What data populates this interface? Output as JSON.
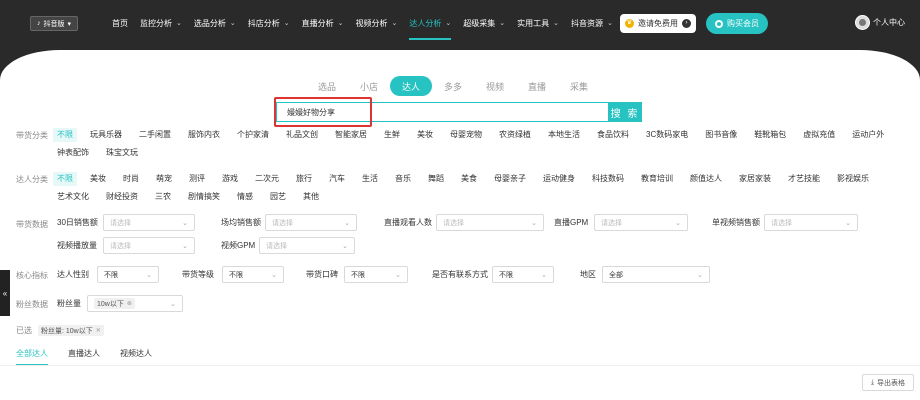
{
  "header": {
    "platform": "抖音版",
    "nav": [
      {
        "label": "首页",
        "chev": false,
        "active": false
      },
      {
        "label": "监控分析",
        "chev": true,
        "active": false
      },
      {
        "label": "选品分析",
        "chev": true,
        "active": false
      },
      {
        "label": "抖店分析",
        "chev": true,
        "active": false
      },
      {
        "label": "直播分析",
        "chev": true,
        "active": false
      },
      {
        "label": "视频分析",
        "chev": true,
        "active": false
      },
      {
        "label": "达人分析",
        "chev": true,
        "active": true
      },
      {
        "label": "超级采集",
        "chev": true,
        "active": false
      },
      {
        "label": "实用工具",
        "chev": true,
        "active": false
      },
      {
        "label": "抖音资源",
        "chev": true,
        "active": false
      }
    ],
    "invite_label": "邀请免费用",
    "buy_label": "购买会员",
    "user_label": "个人中心"
  },
  "tabs": [
    {
      "label": "选品",
      "active": false
    },
    {
      "label": "小店",
      "active": false
    },
    {
      "label": "达人",
      "active": true
    },
    {
      "label": "多多",
      "active": false
    },
    {
      "label": "视频",
      "active": false
    },
    {
      "label": "直播",
      "active": false
    },
    {
      "label": "采集",
      "active": false
    }
  ],
  "search": {
    "value": "嫚嫚好物分享",
    "button": "搜 索"
  },
  "categories": {
    "label": "带货分类",
    "items": [
      "不限",
      "玩具乐器",
      "二手闲置",
      "服饰内衣",
      "个护家清",
      "礼品文创",
      "智能家居",
      "生鲜",
      "美妆",
      "母婴宠物",
      "农资绿植",
      "本地生活",
      "食品饮料",
      "3C数码家电",
      "图书音像",
      "鞋靴箱包",
      "虚拟充值",
      "运动户外",
      "钟表配饰",
      "珠宝文玩"
    ]
  },
  "talent_categories": {
    "label": "达人分类",
    "items": [
      "不限",
      "美妆",
      "时尚",
      "萌宠",
      "测评",
      "游戏",
      "二次元",
      "旅行",
      "汽车",
      "生活",
      "音乐",
      "舞蹈",
      "美食",
      "母婴亲子",
      "运动健身",
      "科技数码",
      "教育培训",
      "颜值达人",
      "家居家装",
      "才艺技能",
      "影视娱乐",
      "艺术文化",
      "财经投资",
      "三农",
      "剧情搞笑",
      "情感",
      "园艺",
      "其他"
    ]
  },
  "sales_data": {
    "label": "带货数据",
    "fields": [
      {
        "label": "30日销售额",
        "placeholder": "请选择"
      },
      {
        "label": "场均销售额",
        "placeholder": "请选择"
      },
      {
        "label": "直播观看人数",
        "placeholder": "请选择"
      },
      {
        "label": "直播GPM",
        "placeholder": "请选择"
      },
      {
        "label": "单视频销售额",
        "placeholder": "请选择"
      },
      {
        "label": "视频播放量",
        "placeholder": "请选择"
      },
      {
        "label": "视频GPM",
        "placeholder": "请选择"
      }
    ]
  },
  "core": {
    "label": "核心指标",
    "fields": [
      {
        "label": "达人性别",
        "value": "不限"
      },
      {
        "label": "带货等级",
        "value": "不限"
      },
      {
        "label": "带货口碑",
        "value": "不限"
      },
      {
        "label": "是否有联系方式",
        "value": "不限"
      },
      {
        "label": "地区",
        "value": "全部"
      }
    ]
  },
  "fans": {
    "label": "粉丝数据",
    "field_label": "粉丝量",
    "value": "10w以下"
  },
  "selected": {
    "label": "已选",
    "tag": "粉丝量: 10w以下"
  },
  "bottom_tabs": [
    {
      "label": "全部达人",
      "active": true
    },
    {
      "label": "直播达人",
      "active": false
    },
    {
      "label": "视频达人",
      "active": false
    }
  ],
  "export_label": "导出表格",
  "colors": {
    "accent": "#27c2c2",
    "header_bg": "#2a2a2a",
    "highlight": "#dd3333"
  }
}
